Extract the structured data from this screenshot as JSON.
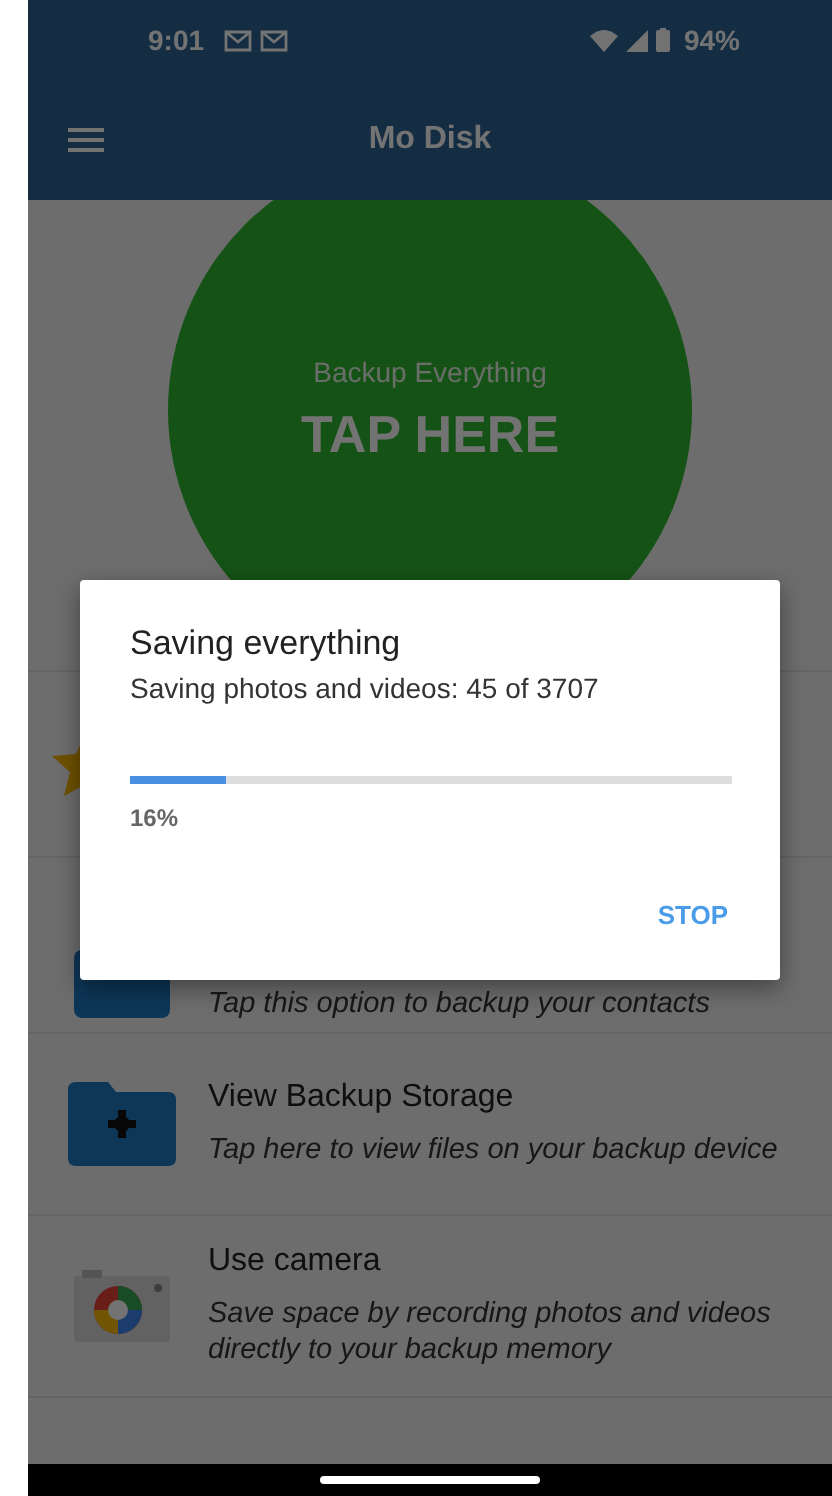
{
  "status_bar": {
    "time": "9:01",
    "battery": "94%"
  },
  "app_bar": {
    "title": "Mo Disk"
  },
  "backup_button": {
    "label": "Backup Everything",
    "action": "TAP HERE"
  },
  "options": [
    {
      "kind": "hidden"
    },
    {
      "kind": "partial",
      "subtitle": "Tap this option to backup your contacts"
    },
    {
      "kind": "full",
      "title": "View Backup Storage",
      "subtitle": "Tap here to view files on your backup device"
    },
    {
      "kind": "full",
      "title": "Use camera",
      "subtitle": "Save space by recording photos and videos directly to your backup memory"
    }
  ],
  "dialog": {
    "title": "Saving everything",
    "message": "Saving photos and videos: 45 of 3707",
    "level": 0.16,
    "percent": "16%",
    "button": "STOP"
  }
}
